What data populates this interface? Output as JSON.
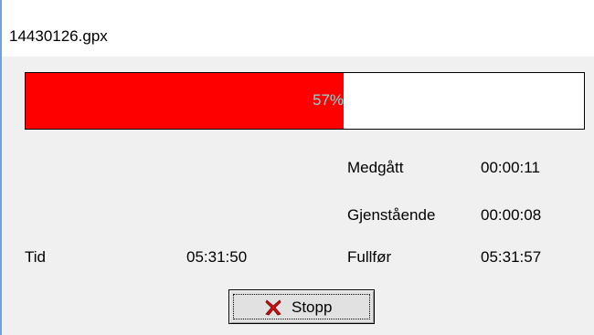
{
  "window": {
    "title": "14430126.gpx"
  },
  "progress": {
    "percent": 57,
    "label": "57%",
    "fill_color": "#ff0000"
  },
  "stats": {
    "elapsed_label": "Medgått",
    "elapsed_value": "00:00:11",
    "remaining_label": "Gjenstående",
    "remaining_value": "00:00:08",
    "time_label": "Tid",
    "time_value": "05:31:50",
    "finish_label": "Fullfør",
    "finish_value": "05:31:57"
  },
  "stop_button": {
    "label": "Stopp",
    "icon": "red-x-icon"
  }
}
